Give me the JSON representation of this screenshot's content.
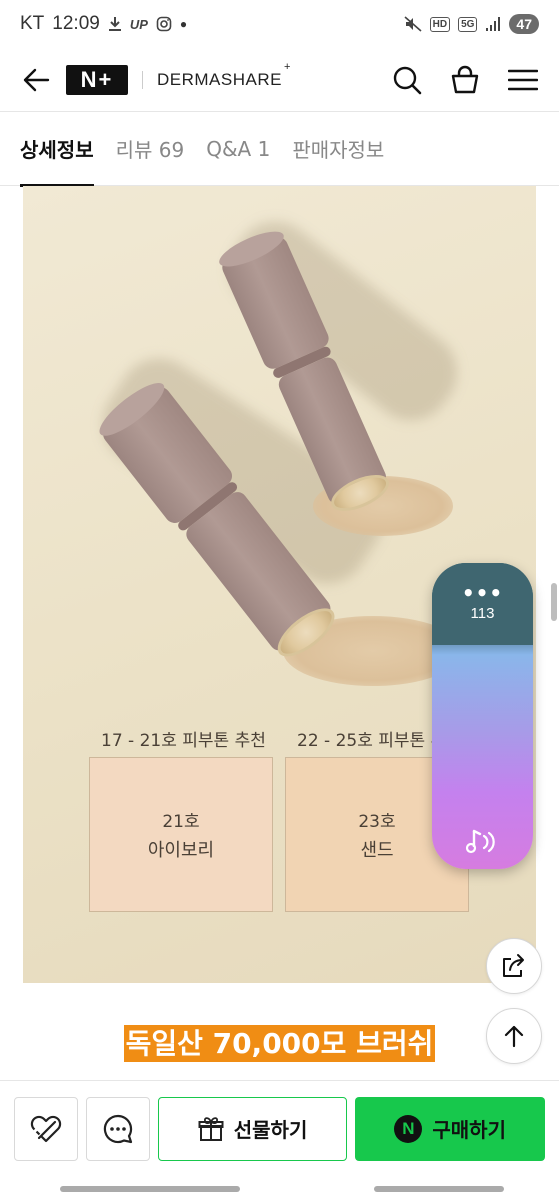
{
  "status_bar": {
    "carrier": "KT",
    "time": "12:09",
    "up_label": "UP",
    "battery": "47",
    "network": "5G",
    "hd": "HD"
  },
  "header": {
    "logo_text": "N+",
    "brand": "DERMASHARE",
    "brand_mark": "+"
  },
  "tabs": [
    {
      "label": "상세정보",
      "active": true
    },
    {
      "label": "리뷰 69",
      "active": false
    },
    {
      "label": "Q&A 1",
      "active": false
    },
    {
      "label": "판매자정보",
      "active": false
    }
  ],
  "product_image": {
    "shades": [
      {
        "caption": "17 - 21호 피부톤 추천",
        "number": "21호",
        "name": "아이보리"
      },
      {
        "caption": "22 - 25호 피부톤 추",
        "number": "23호",
        "name": "샌드"
      }
    ]
  },
  "float_widget": {
    "dots": "•••",
    "value": "113"
  },
  "promo": {
    "text": "독일산 70,000모 브러쉬"
  },
  "bottom_bar": {
    "gift_label": "선물하기",
    "buy_label": "구매하기",
    "buy_logo": "N"
  },
  "colors": {
    "accent_green": "#17c84c",
    "promo_orange": "#f08d14"
  }
}
